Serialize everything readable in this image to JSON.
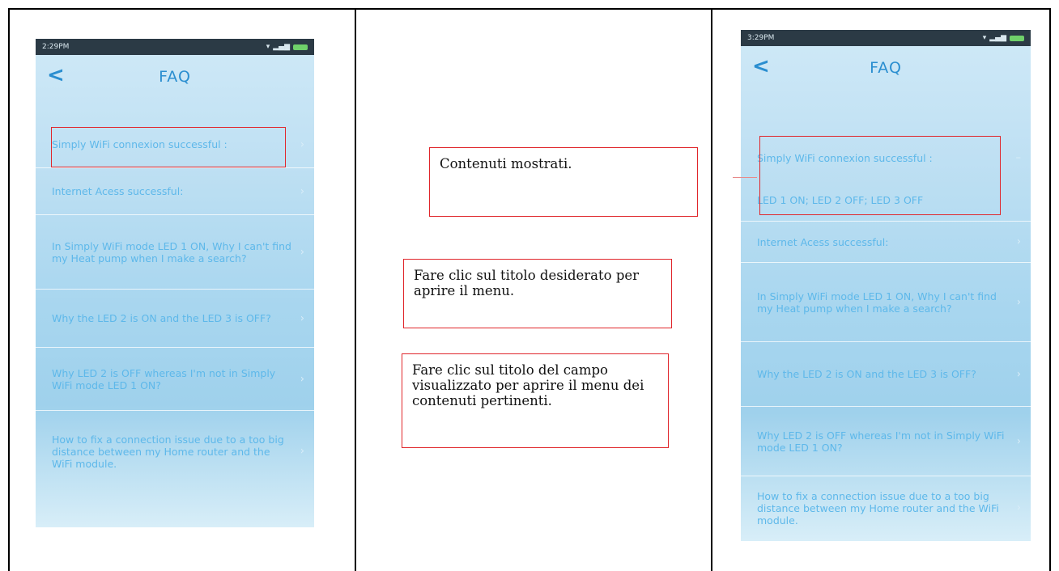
{
  "left_phone": {
    "status_time": "2:29PM",
    "title": "FAQ",
    "items": [
      "Simply WiFi connexion successful :",
      "Internet Acess successful:",
      "In Simply WiFi mode LED 1 ON, Why I can't find my Heat pump when I make a search?",
      "Why the LED 2 is ON and the LED 3 is OFF?",
      "Why LED 2 is OFF whereas I'm not in Simply WiFi mode LED 1 ON?",
      "How to fix a connection issue due to a too big distance between my Home router and the WiFi module."
    ]
  },
  "right_phone": {
    "status_time": "3:29PM",
    "title": "FAQ",
    "expanded_item": "Simply WiFi connexion successful :",
    "expanded_answer": "LED 1 ON; LED 2 OFF; LED 3 OFF",
    "items": [
      "Internet Acess successful:",
      "In Simply WiFi mode LED 1 ON, Why I can't find my Heat pump when I make a search?",
      "Why the LED 2 is ON and the LED 3 is OFF?",
      "Why LED 2 is OFF whereas I'm not in Simply WiFi mode LED 1 ON?",
      "How to fix a connection issue due to a too big distance between my Home router and the WiFi module."
    ]
  },
  "callouts": {
    "contents_shown": "Contenuti mostrati.",
    "click_title": "Fare clic sul titolo desiderato per aprire il menu.",
    "click_field": "Fare clic sul titolo del campo visualizzato per aprire il menu dei contenuti pertinenti."
  },
  "icons": {
    "back": "chevron-left-icon",
    "row": "chevron-right-icon"
  },
  "colors": {
    "accent": "#2a8ed0",
    "highlight_box": "#e0262b"
  }
}
